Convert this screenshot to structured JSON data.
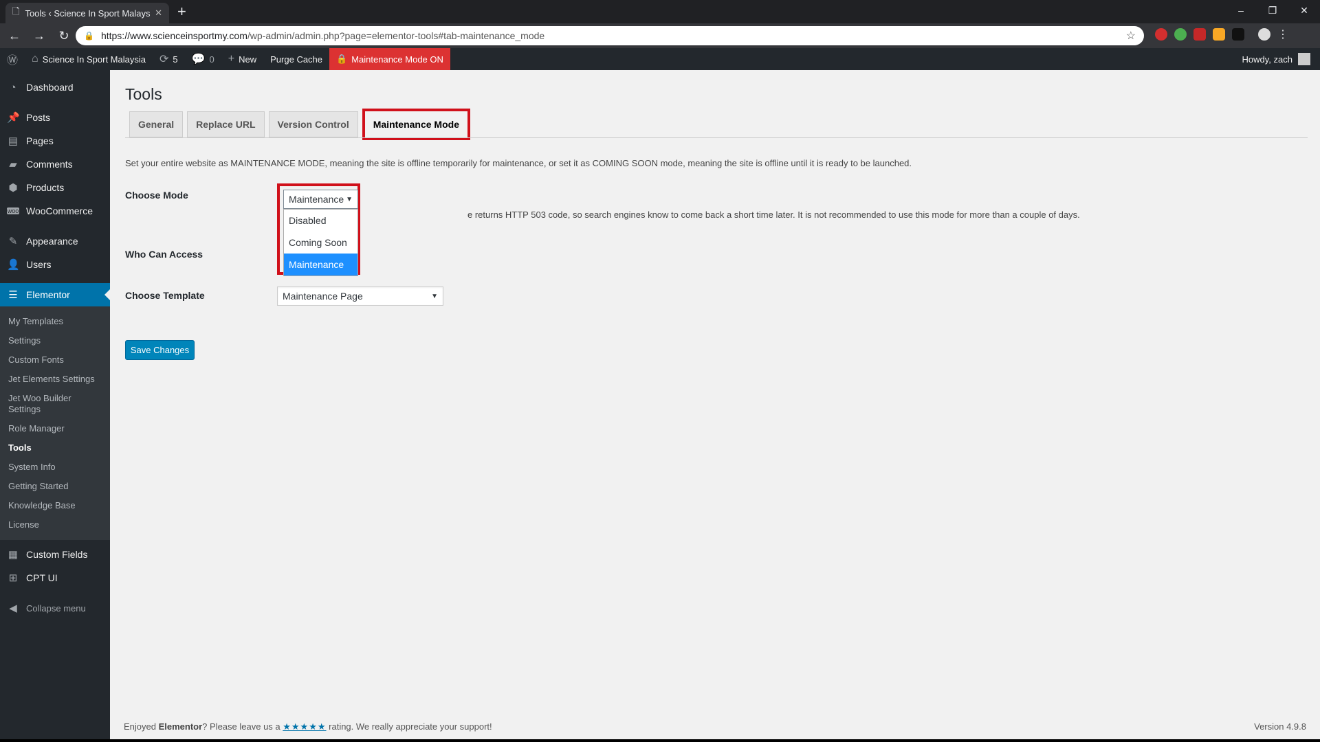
{
  "browser": {
    "tab_title": "Tools ‹ Science In Sport Malaysia",
    "url_domain": "https://www.scienceinsportmy.com",
    "url_path": "/wp-admin/admin.php?page=elementor-tools#tab-maintenance_mode"
  },
  "adminbar": {
    "site_name": "Science In Sport Malaysia",
    "updates_count": "5",
    "comments_count": "0",
    "new_label": "New",
    "purge_label": "Purge Cache",
    "maintenance_label": "Maintenance Mode ON",
    "howdy": "Howdy, zach"
  },
  "sidebar": {
    "dashboard": "Dashboard",
    "posts": "Posts",
    "pages": "Pages",
    "comments": "Comments",
    "products": "Products",
    "woocommerce": "WooCommerce",
    "appearance": "Appearance",
    "users": "Users",
    "elementor": "Elementor",
    "submenu": [
      "My Templates",
      "Settings",
      "Custom Fonts",
      "Jet Elements Settings",
      "Jet Woo Builder Settings",
      "Role Manager",
      "Tools",
      "System Info",
      "Getting Started",
      "Knowledge Base",
      "License"
    ],
    "custom_fields": "Custom Fields",
    "cpt_ui": "CPT UI",
    "collapse": "Collapse menu"
  },
  "main": {
    "title": "Tools",
    "tabs": [
      "General",
      "Replace URL",
      "Version Control",
      "Maintenance Mode"
    ],
    "description": "Set your entire website as MAINTENANCE MODE, meaning the site is offline temporarily for maintenance, or set it as COMING SOON mode, meaning the site is offline until it is ready to be launched.",
    "choose_mode_label": "Choose Mode",
    "mode_selected": "Maintenance",
    "mode_options": [
      "Disabled",
      "Coming Soon",
      "Maintenance"
    ],
    "mode_note": "e returns HTTP 503 code, so search engines know to come back a short time later. It is not recommended to use this mode for more than a couple of days.",
    "who_label": "Who Can Access",
    "template_label": "Choose Template",
    "template_selected": "Maintenance Page",
    "save_label": "Save Changes"
  },
  "footer": {
    "pre": "Enjoyed ",
    "brand": "Elementor",
    "mid": "? Please leave us a ",
    "stars": "★★★★★",
    "post": " rating. We really appreciate your support!",
    "version": "Version 4.9.8"
  },
  "colors": {
    "accent": "#0073aa",
    "highlight": "#d0101a",
    "maintenance_bg": "#dc3232"
  }
}
